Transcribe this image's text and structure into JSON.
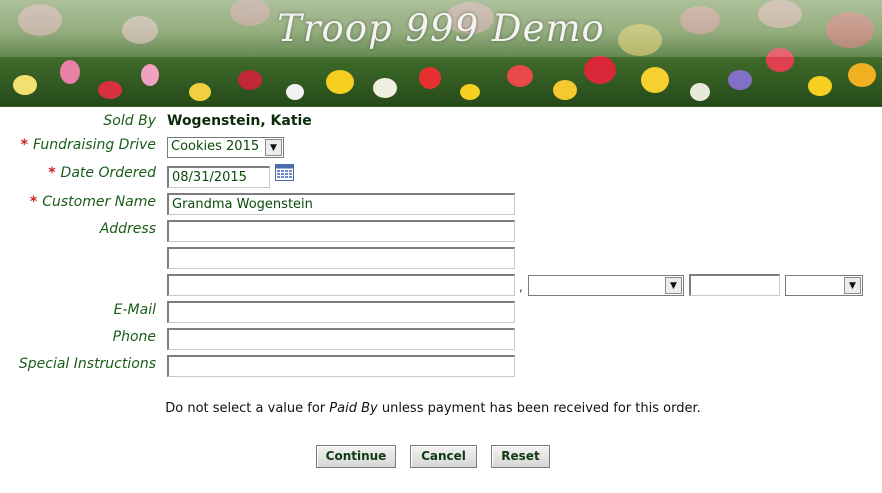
{
  "banner": {
    "title": "Troop 999 Demo"
  },
  "form": {
    "sold_by": {
      "label": "Sold By",
      "value": "Wogenstein, Katie"
    },
    "fundraising_drive": {
      "required_mark": "*",
      "label": "Fundraising Drive",
      "selected": "Cookies 2015"
    },
    "date_ordered": {
      "required_mark": "*",
      "label": "Date Ordered",
      "value": "08/31/2015"
    },
    "customer_name": {
      "required_mark": "*",
      "label": "Customer Name",
      "value": "Grandma Wogenstein"
    },
    "address": {
      "label": "Address",
      "line1": "",
      "line2": "",
      "city": "",
      "city_separator": ",",
      "state": "",
      "zip": "",
      "country": ""
    },
    "email": {
      "label": "E-Mail",
      "value": ""
    },
    "phone": {
      "label": "Phone",
      "value": ""
    },
    "special_instructions": {
      "label": "Special Instructions",
      "value": ""
    }
  },
  "notice": {
    "before": "Do not select a value for ",
    "emphasis": "Paid By",
    "after": " unless payment has been received for this order."
  },
  "buttons": {
    "continue": "Continue",
    "cancel": "Cancel",
    "reset": "Reset"
  },
  "colors": {
    "label": "#1a5c1a",
    "required": "#cc2222",
    "banner_green": "#3f6b2a"
  }
}
